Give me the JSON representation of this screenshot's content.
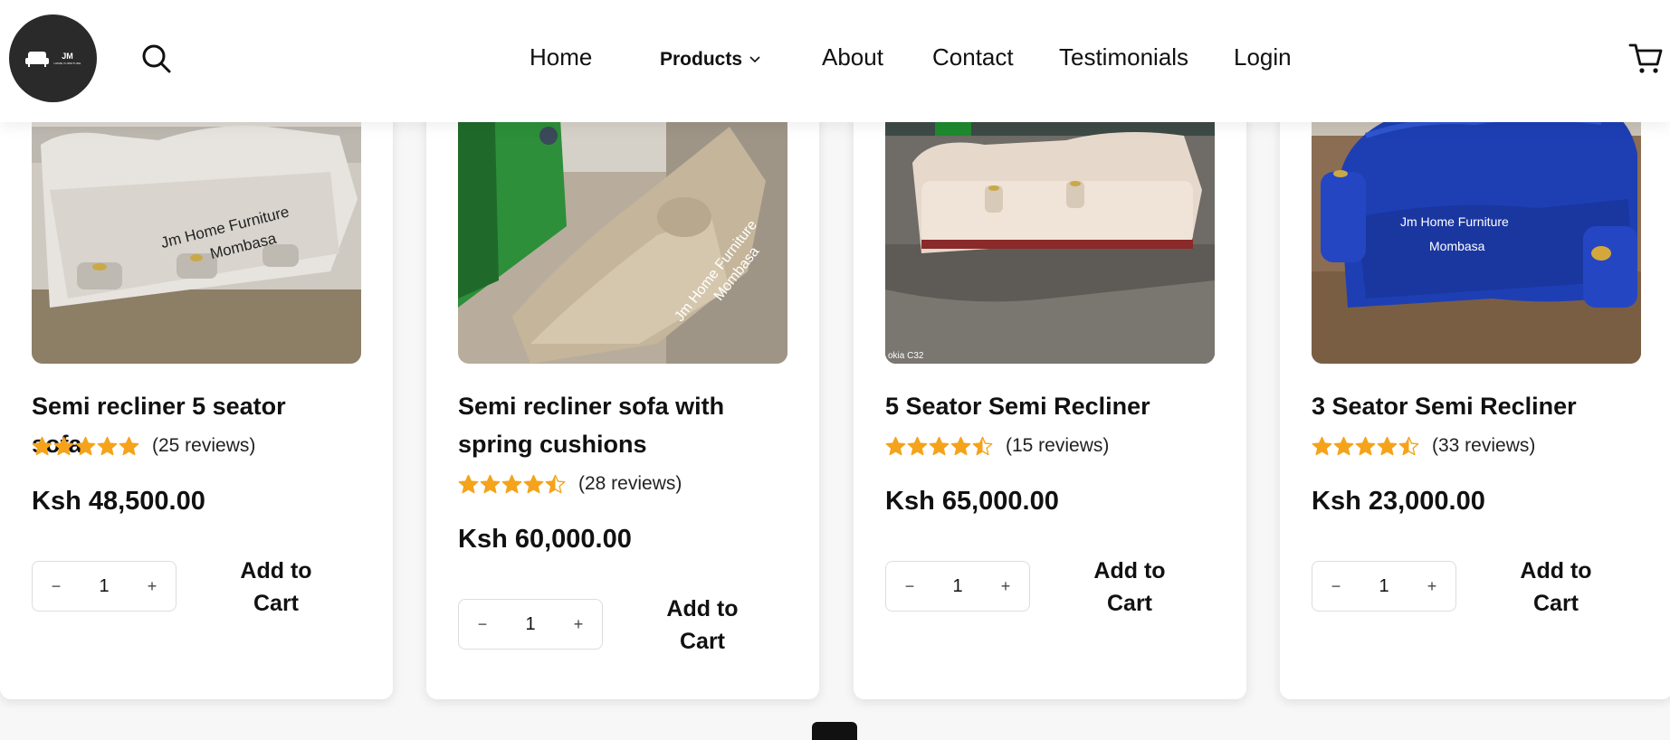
{
  "header": {
    "logo": {
      "text": "JM",
      "subtext": "HOME FURNITURE"
    },
    "nav": {
      "home": "Home",
      "products": "Products",
      "about": "About",
      "contact": "Contact",
      "testimonials": "Testimonials",
      "login": "Login"
    },
    "icons": [
      "search-icon",
      "chevron-down-icon",
      "cart-icon"
    ]
  },
  "products": [
    {
      "title": "Semi recliner 5 seator sofa",
      "stars": 5,
      "reviews": "(25 reviews)",
      "price": "Ksh 48,500.00",
      "qty": "1",
      "add_label": "Add to Cart",
      "watermark": "Jm Home Furniture Mombasa"
    },
    {
      "title": "Semi recliner sofa with spring cushions",
      "stars": 4.5,
      "reviews": "(28 reviews)",
      "price": "Ksh 60,000.00",
      "qty": "1",
      "add_label": "Add to Cart",
      "watermark": "Jm Home Furniture Mombasa"
    },
    {
      "title": "5 Seator Semi Recliner",
      "stars": 4.5,
      "reviews": "(15 reviews)",
      "price": "Ksh 65,000.00",
      "qty": "1",
      "add_label": "Add to Cart",
      "watermark": "okia C32"
    },
    {
      "title": "3 Seator Semi Recliner",
      "stars": 4.5,
      "reviews": "(33 reviews)",
      "price": "Ksh 23,000.00",
      "qty": "1",
      "add_label": "Add to Cart",
      "watermark": "Jm Home Furniture Mombasa"
    }
  ],
  "colors": {
    "star": "#f5a31a",
    "text": "#111111",
    "logo_bg": "#2a2a2a"
  }
}
